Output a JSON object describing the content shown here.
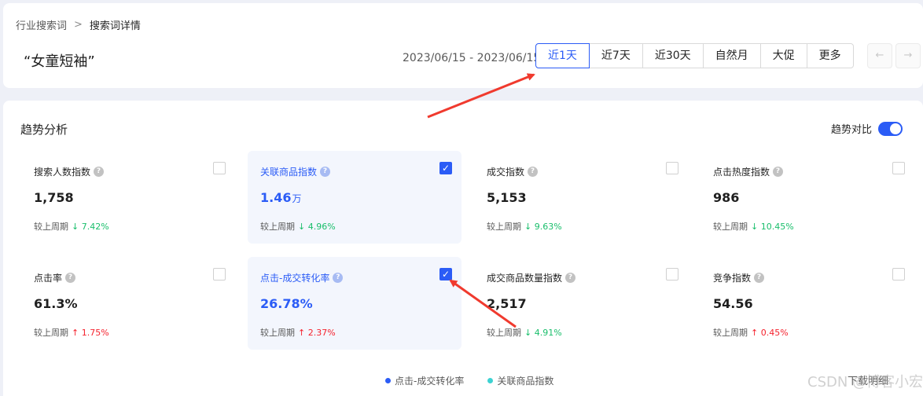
{
  "breadcrumb": {
    "parent": "行业搜索词",
    "separator": ">",
    "current": "搜索词详情"
  },
  "keyword": "“女童短袖”",
  "date_range": "2023/06/15 - 2023/06/15",
  "range_buttons": [
    "近1天",
    "近7天",
    "近30天",
    "自然月",
    "大促",
    "更多"
  ],
  "active_range": "近1天",
  "nav": {
    "prev": "←",
    "next": "→"
  },
  "trend": {
    "title": "趋势分析",
    "compare_label": "趋势对比",
    "compare_on": true
  },
  "compare_prefix": "较上周期",
  "metrics": [
    {
      "label": "搜索人数指数",
      "value": "1,758",
      "unit": "",
      "direction": "↓",
      "change": "7.42%",
      "checked": false
    },
    {
      "label": "关联商品指数",
      "value": "1.46",
      "unit": "万",
      "direction": "↓",
      "change": "4.96%",
      "checked": true
    },
    {
      "label": "成交指数",
      "value": "5,153",
      "unit": "",
      "direction": "↓",
      "change": "9.63%",
      "checked": false
    },
    {
      "label": "点击热度指数",
      "value": "986",
      "unit": "",
      "direction": "↓",
      "change": "10.45%",
      "checked": false
    },
    {
      "label": "点击率",
      "value": "61.3%",
      "unit": "",
      "direction": "↑",
      "change": "1.75%",
      "checked": false
    },
    {
      "label": "点击-成交转化率",
      "value": "26.78%",
      "unit": "",
      "direction": "↑",
      "change": "2.37%",
      "checked": true
    },
    {
      "label": "成交商品数量指数",
      "value": "2,517",
      "unit": "",
      "direction": "↓",
      "change": "4.91%",
      "checked": false
    },
    {
      "label": "竞争指数",
      "value": "54.56",
      "unit": "",
      "direction": "↑",
      "change": "0.45%",
      "checked": false
    }
  ],
  "legend": [
    {
      "label": "点击-成交转化率",
      "color": "#2b5cf6"
    },
    {
      "label": "关联商品指数",
      "color": "#3dd2d2"
    }
  ],
  "download_label": "下载明细",
  "watermark": "CSDN @博客小宏",
  "colors": {
    "accent": "#2b5cf6",
    "down": "#19be6b",
    "up": "#f5222d",
    "annotation": "#f03a2e"
  }
}
